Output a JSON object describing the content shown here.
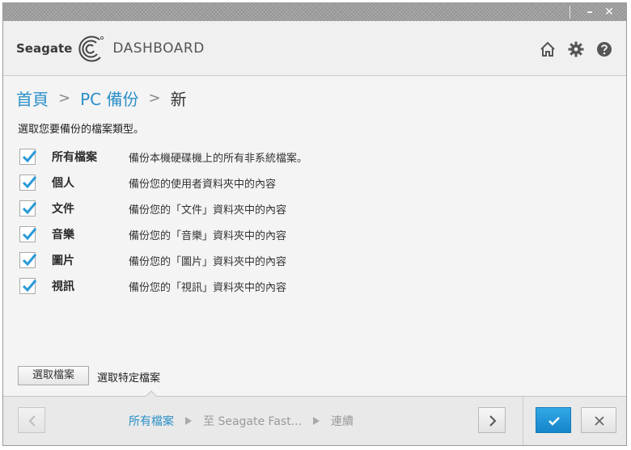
{
  "titlebar": {
    "minimize_glyph": "–",
    "close_glyph": "✕"
  },
  "header": {
    "brand_name": "Seagate",
    "app_name": "DASHBOARD",
    "icons": [
      "home-icon",
      "gear-icon",
      "help-icon"
    ]
  },
  "breadcrumb": {
    "items": [
      "首頁",
      "PC 備份",
      "新"
    ],
    "separator": ">"
  },
  "instruction": "選取您要備份的檔案類型。",
  "file_types": [
    {
      "label": "所有檔案",
      "description": "備份本機硬碟機上的所有非系統檔案。",
      "checked": true
    },
    {
      "label": "個人",
      "description": "備份您的使用者資料夾中的內容",
      "checked": true
    },
    {
      "label": "文件",
      "description": "備份您的「文件」資料夾中的內容",
      "checked": true
    },
    {
      "label": "音樂",
      "description": "備份您的「音樂」資料夾中的內容",
      "checked": true
    },
    {
      "label": "圖片",
      "description": "備份您的「圖片」資料夾中的內容",
      "checked": true
    },
    {
      "label": "視訊",
      "description": "備份您的「視訊」資料夾中的內容",
      "checked": true
    }
  ],
  "select_files": {
    "button_label": "選取檔案",
    "text": "選取特定檔案"
  },
  "footer": {
    "steps": [
      "所有檔案",
      "至 Seagate Fast...",
      "連續"
    ],
    "active_step": 0
  },
  "colors": {
    "accent": "#2a8fc8",
    "ok_button": "#1e95d6",
    "check": "#2a9ad8"
  }
}
